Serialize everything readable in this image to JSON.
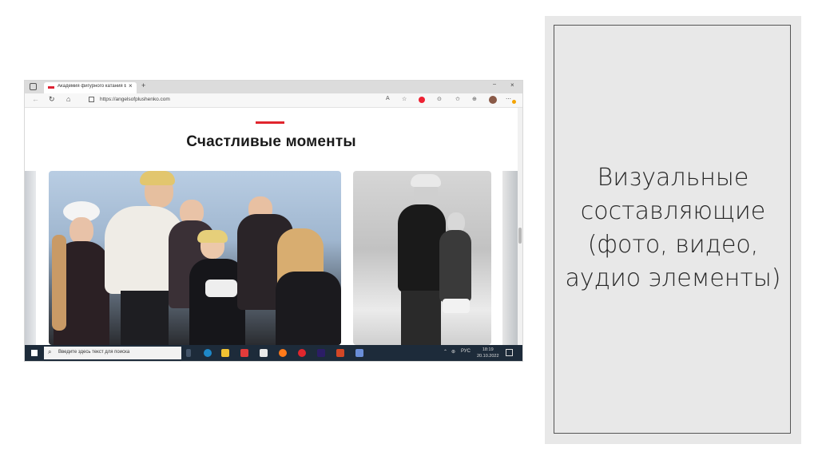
{
  "browser": {
    "tab_title": "Академия фигурного катания Е",
    "tab_close": "×",
    "new_tab": "+",
    "window_min": "⎯",
    "window_close": "×",
    "url": "https://angelsofplushenko.com",
    "toolbar_text_size": "Aᴬ"
  },
  "page": {
    "heading": "Счастливые моменты"
  },
  "taskbar": {
    "search_placeholder": "Введите здесь текст для поиска",
    "language": "РУС",
    "time": "18:19",
    "date": "20.10.2022"
  },
  "panel": {
    "lines": [
      "Визуальные",
      "составляющие",
      "(фото, видео,",
      "аудио элементы)"
    ]
  },
  "colors": {
    "accent_red": "#e0252d",
    "taskbar": "#1d2b3a",
    "panel_bg": "#e8e8e8"
  },
  "icons": {
    "back": "arrow-left-icon",
    "refresh": "refresh-icon",
    "home": "home-icon",
    "favorites": "star-icon",
    "search": "magnifier-icon"
  }
}
